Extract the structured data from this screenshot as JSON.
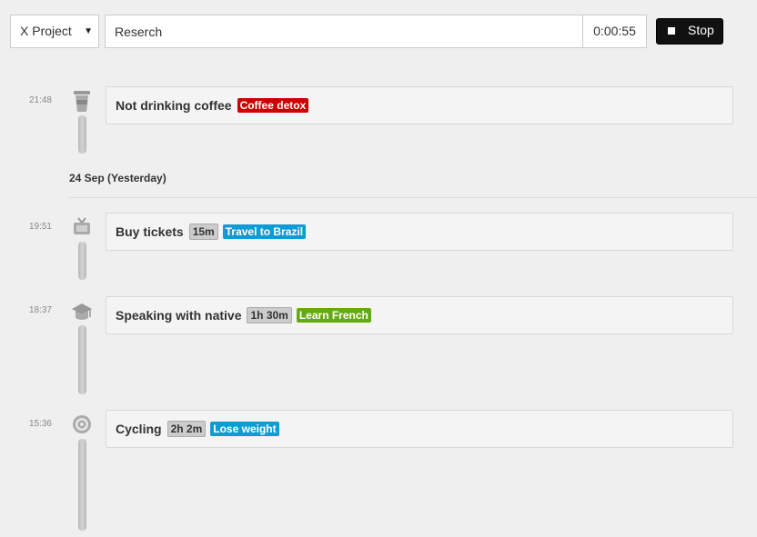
{
  "toolbar": {
    "project": "X Project",
    "task_value": "Reserch",
    "timer": "0:00:55",
    "stop_label": "Stop"
  },
  "entries": [
    {
      "time": "21:48",
      "title": "Not drinking coffee",
      "duration": "",
      "tag": "Coffee detox",
      "tag_color": "#cc0000",
      "icon": "coffee-cup-icon"
    },
    {
      "time": "19:51",
      "title": "Buy tickets",
      "duration": "15m",
      "tag": "Travel to Brazil",
      "tag_color": "#0f9bd3",
      "icon": "tv-icon"
    },
    {
      "time": "18:37",
      "title": "Speaking with native",
      "duration": "1h 30m",
      "tag": "Learn French",
      "tag_color": "#66aa11",
      "icon": "graduation-cap-icon"
    },
    {
      "time": "15:36",
      "title": "Cycling",
      "duration": "2h 2m",
      "tag": "Lose weight",
      "tag_color": "#0f9bd3",
      "icon": "target-icon"
    }
  ],
  "date_header": "24 Sep (Yesterday)"
}
